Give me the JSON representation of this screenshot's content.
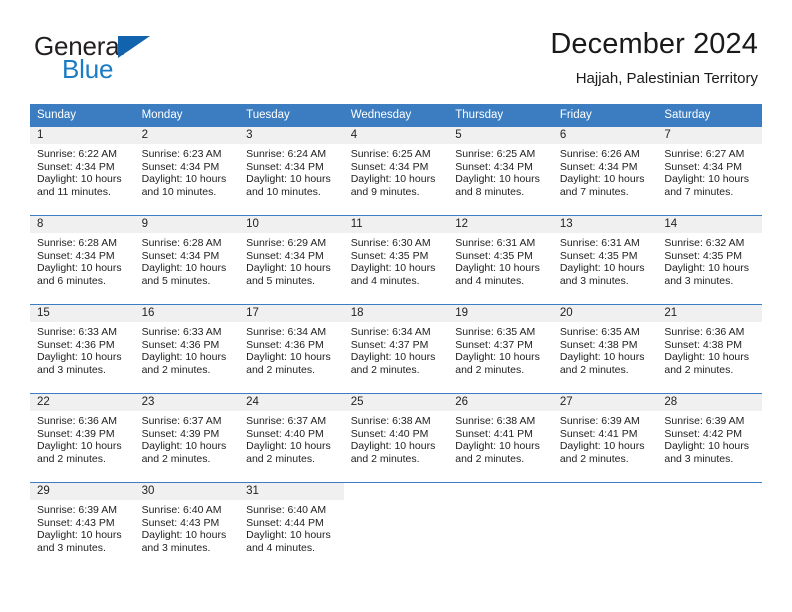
{
  "brand": {
    "name_part1": "General",
    "name_part2": "Blue",
    "triangle_color": "#1263ad",
    "blue_text_color": "#1b7bc4"
  },
  "header": {
    "title": "December 2024",
    "subtitle": "Hajjah, Palestinian Territory"
  },
  "theme": {
    "header_blue": "#3b7dc0",
    "daynum_band": "#f0f0f0",
    "text": "#222222"
  },
  "weekday_headers": [
    "Sunday",
    "Monday",
    "Tuesday",
    "Wednesday",
    "Thursday",
    "Friday",
    "Saturday"
  ],
  "weeks": [
    {
      "days": [
        {
          "daynum": "1",
          "sunrise": "Sunrise: 6:22 AM",
          "sunset": "Sunset: 4:34 PM",
          "daylight1": "Daylight: 10 hours",
          "daylight2": "and 11 minutes."
        },
        {
          "daynum": "2",
          "sunrise": "Sunrise: 6:23 AM",
          "sunset": "Sunset: 4:34 PM",
          "daylight1": "Daylight: 10 hours",
          "daylight2": "and 10 minutes."
        },
        {
          "daynum": "3",
          "sunrise": "Sunrise: 6:24 AM",
          "sunset": "Sunset: 4:34 PM",
          "daylight1": "Daylight: 10 hours",
          "daylight2": "and 10 minutes."
        },
        {
          "daynum": "4",
          "sunrise": "Sunrise: 6:25 AM",
          "sunset": "Sunset: 4:34 PM",
          "daylight1": "Daylight: 10 hours",
          "daylight2": "and 9 minutes."
        },
        {
          "daynum": "5",
          "sunrise": "Sunrise: 6:25 AM",
          "sunset": "Sunset: 4:34 PM",
          "daylight1": "Daylight: 10 hours",
          "daylight2": "and 8 minutes."
        },
        {
          "daynum": "6",
          "sunrise": "Sunrise: 6:26 AM",
          "sunset": "Sunset: 4:34 PM",
          "daylight1": "Daylight: 10 hours",
          "daylight2": "and 7 minutes."
        },
        {
          "daynum": "7",
          "sunrise": "Sunrise: 6:27 AM",
          "sunset": "Sunset: 4:34 PM",
          "daylight1": "Daylight: 10 hours",
          "daylight2": "and 7 minutes."
        }
      ]
    },
    {
      "days": [
        {
          "daynum": "8",
          "sunrise": "Sunrise: 6:28 AM",
          "sunset": "Sunset: 4:34 PM",
          "daylight1": "Daylight: 10 hours",
          "daylight2": "and 6 minutes."
        },
        {
          "daynum": "9",
          "sunrise": "Sunrise: 6:28 AM",
          "sunset": "Sunset: 4:34 PM",
          "daylight1": "Daylight: 10 hours",
          "daylight2": "and 5 minutes."
        },
        {
          "daynum": "10",
          "sunrise": "Sunrise: 6:29 AM",
          "sunset": "Sunset: 4:34 PM",
          "daylight1": "Daylight: 10 hours",
          "daylight2": "and 5 minutes."
        },
        {
          "daynum": "11",
          "sunrise": "Sunrise: 6:30 AM",
          "sunset": "Sunset: 4:35 PM",
          "daylight1": "Daylight: 10 hours",
          "daylight2": "and 4 minutes."
        },
        {
          "daynum": "12",
          "sunrise": "Sunrise: 6:31 AM",
          "sunset": "Sunset: 4:35 PM",
          "daylight1": "Daylight: 10 hours",
          "daylight2": "and 4 minutes."
        },
        {
          "daynum": "13",
          "sunrise": "Sunrise: 6:31 AM",
          "sunset": "Sunset: 4:35 PM",
          "daylight1": "Daylight: 10 hours",
          "daylight2": "and 3 minutes."
        },
        {
          "daynum": "14",
          "sunrise": "Sunrise: 6:32 AM",
          "sunset": "Sunset: 4:35 PM",
          "daylight1": "Daylight: 10 hours",
          "daylight2": "and 3 minutes."
        }
      ]
    },
    {
      "days": [
        {
          "daynum": "15",
          "sunrise": "Sunrise: 6:33 AM",
          "sunset": "Sunset: 4:36 PM",
          "daylight1": "Daylight: 10 hours",
          "daylight2": "and 3 minutes."
        },
        {
          "daynum": "16",
          "sunrise": "Sunrise: 6:33 AM",
          "sunset": "Sunset: 4:36 PM",
          "daylight1": "Daylight: 10 hours",
          "daylight2": "and 2 minutes."
        },
        {
          "daynum": "17",
          "sunrise": "Sunrise: 6:34 AM",
          "sunset": "Sunset: 4:36 PM",
          "daylight1": "Daylight: 10 hours",
          "daylight2": "and 2 minutes."
        },
        {
          "daynum": "18",
          "sunrise": "Sunrise: 6:34 AM",
          "sunset": "Sunset: 4:37 PM",
          "daylight1": "Daylight: 10 hours",
          "daylight2": "and 2 minutes."
        },
        {
          "daynum": "19",
          "sunrise": "Sunrise: 6:35 AM",
          "sunset": "Sunset: 4:37 PM",
          "daylight1": "Daylight: 10 hours",
          "daylight2": "and 2 minutes."
        },
        {
          "daynum": "20",
          "sunrise": "Sunrise: 6:35 AM",
          "sunset": "Sunset: 4:38 PM",
          "daylight1": "Daylight: 10 hours",
          "daylight2": "and 2 minutes."
        },
        {
          "daynum": "21",
          "sunrise": "Sunrise: 6:36 AM",
          "sunset": "Sunset: 4:38 PM",
          "daylight1": "Daylight: 10 hours",
          "daylight2": "and 2 minutes."
        }
      ]
    },
    {
      "days": [
        {
          "daynum": "22",
          "sunrise": "Sunrise: 6:36 AM",
          "sunset": "Sunset: 4:39 PM",
          "daylight1": "Daylight: 10 hours",
          "daylight2": "and 2 minutes."
        },
        {
          "daynum": "23",
          "sunrise": "Sunrise: 6:37 AM",
          "sunset": "Sunset: 4:39 PM",
          "daylight1": "Daylight: 10 hours",
          "daylight2": "and 2 minutes."
        },
        {
          "daynum": "24",
          "sunrise": "Sunrise: 6:37 AM",
          "sunset": "Sunset: 4:40 PM",
          "daylight1": "Daylight: 10 hours",
          "daylight2": "and 2 minutes."
        },
        {
          "daynum": "25",
          "sunrise": "Sunrise: 6:38 AM",
          "sunset": "Sunset: 4:40 PM",
          "daylight1": "Daylight: 10 hours",
          "daylight2": "and 2 minutes."
        },
        {
          "daynum": "26",
          "sunrise": "Sunrise: 6:38 AM",
          "sunset": "Sunset: 4:41 PM",
          "daylight1": "Daylight: 10 hours",
          "daylight2": "and 2 minutes."
        },
        {
          "daynum": "27",
          "sunrise": "Sunrise: 6:39 AM",
          "sunset": "Sunset: 4:41 PM",
          "daylight1": "Daylight: 10 hours",
          "daylight2": "and 2 minutes."
        },
        {
          "daynum": "28",
          "sunrise": "Sunrise: 6:39 AM",
          "sunset": "Sunset: 4:42 PM",
          "daylight1": "Daylight: 10 hours",
          "daylight2": "and 3 minutes."
        }
      ]
    },
    {
      "days": [
        {
          "daynum": "29",
          "sunrise": "Sunrise: 6:39 AM",
          "sunset": "Sunset: 4:43 PM",
          "daylight1": "Daylight: 10 hours",
          "daylight2": "and 3 minutes."
        },
        {
          "daynum": "30",
          "sunrise": "Sunrise: 6:40 AM",
          "sunset": "Sunset: 4:43 PM",
          "daylight1": "Daylight: 10 hours",
          "daylight2": "and 3 minutes."
        },
        {
          "daynum": "31",
          "sunrise": "Sunrise: 6:40 AM",
          "sunset": "Sunset: 4:44 PM",
          "daylight1": "Daylight: 10 hours",
          "daylight2": "and 4 minutes."
        },
        {
          "daynum": "",
          "sunrise": "",
          "sunset": "",
          "daylight1": "",
          "daylight2": ""
        },
        {
          "daynum": "",
          "sunrise": "",
          "sunset": "",
          "daylight1": "",
          "daylight2": ""
        },
        {
          "daynum": "",
          "sunrise": "",
          "sunset": "",
          "daylight1": "",
          "daylight2": ""
        },
        {
          "daynum": "",
          "sunrise": "",
          "sunset": "",
          "daylight1": "",
          "daylight2": ""
        }
      ]
    }
  ]
}
